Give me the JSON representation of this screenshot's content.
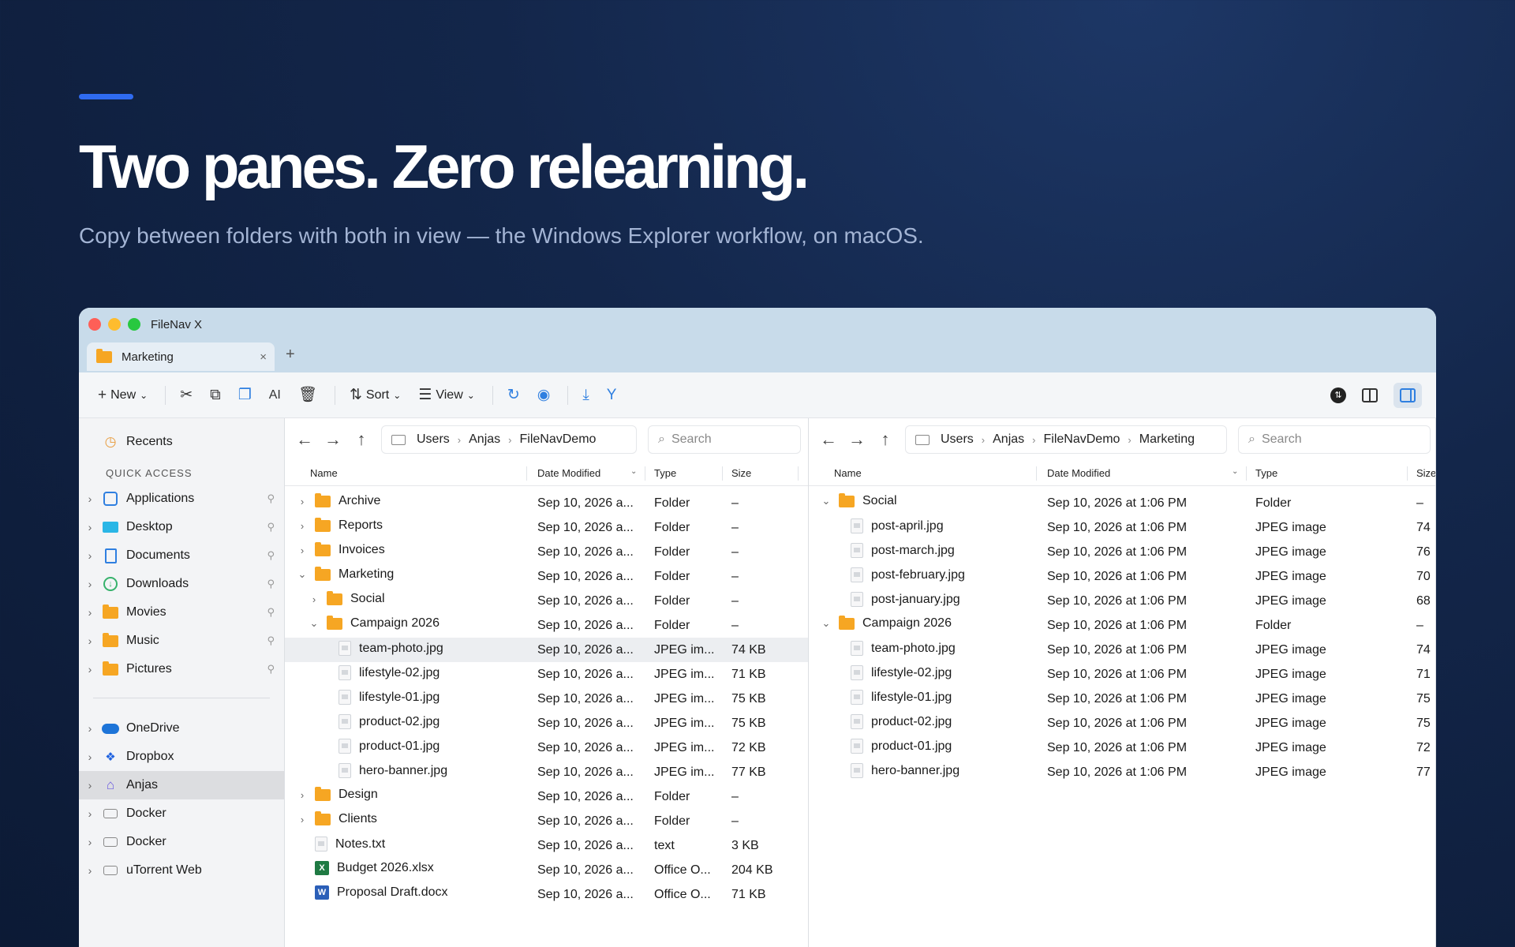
{
  "hero": {
    "headline": "Two panes. Zero relearning.",
    "subline": "Copy between folders with both in view — the Windows Explorer workflow, on macOS."
  },
  "window": {
    "title": "FileNav X",
    "tab": {
      "label": "Marketing",
      "close": "×"
    },
    "new_tab": "+"
  },
  "toolbar": {
    "new_label": "New",
    "sort_label": "Sort",
    "view_label": "View"
  },
  "sidebar": {
    "recents": "Recents",
    "quick_access_header": "QUICK ACCESS",
    "quick_access": [
      "Applications",
      "Desktop",
      "Documents",
      "Downloads",
      "Movies",
      "Music",
      "Pictures"
    ],
    "locations": [
      "OneDrive",
      "Dropbox",
      "Anjas",
      "Docker",
      "Docker",
      "uTorrent Web"
    ]
  },
  "left_pane": {
    "breadcrumb": [
      "Users",
      "Anjas",
      "FileNavDemo"
    ],
    "search_placeholder": "Search",
    "columns": [
      "Name",
      "Date Modified",
      "Type",
      "Size"
    ],
    "rows": [
      {
        "name": "Archive",
        "date": "Sep 10, 2026 a...",
        "type": "Folder",
        "size": "–",
        "level": 0,
        "kind": "folder",
        "chev": "›"
      },
      {
        "name": "Reports",
        "date": "Sep 10, 2026 a...",
        "type": "Folder",
        "size": "–",
        "level": 0,
        "kind": "folder",
        "chev": "›"
      },
      {
        "name": "Invoices",
        "date": "Sep 10, 2026 a...",
        "type": "Folder",
        "size": "–",
        "level": 0,
        "kind": "folder",
        "chev": "›"
      },
      {
        "name": "Marketing",
        "date": "Sep 10, 2026 a...",
        "type": "Folder",
        "size": "–",
        "level": 0,
        "kind": "folder",
        "chev": "⌄"
      },
      {
        "name": "Social",
        "date": "Sep 10, 2026 a...",
        "type": "Folder",
        "size": "–",
        "level": 1,
        "kind": "folder",
        "chev": "›"
      },
      {
        "name": "Campaign 2026",
        "date": "Sep 10, 2026 a...",
        "type": "Folder",
        "size": "–",
        "level": 1,
        "kind": "folder",
        "chev": "⌄"
      },
      {
        "name": "team-photo.jpg",
        "date": "Sep 10, 2026 a...",
        "type": "JPEG im...",
        "size": "74 KB",
        "level": 2,
        "kind": "file",
        "chev": ""
      },
      {
        "name": "lifestyle-02.jpg",
        "date": "Sep 10, 2026 a...",
        "type": "JPEG im...",
        "size": "71 KB",
        "level": 2,
        "kind": "file",
        "chev": ""
      },
      {
        "name": "lifestyle-01.jpg",
        "date": "Sep 10, 2026 a...",
        "type": "JPEG im...",
        "size": "75 KB",
        "level": 2,
        "kind": "file",
        "chev": ""
      },
      {
        "name": "product-02.jpg",
        "date": "Sep 10, 2026 a...",
        "type": "JPEG im...",
        "size": "75 KB",
        "level": 2,
        "kind": "file",
        "chev": ""
      },
      {
        "name": "product-01.jpg",
        "date": "Sep 10, 2026 a...",
        "type": "JPEG im...",
        "size": "72 KB",
        "level": 2,
        "kind": "file",
        "chev": ""
      },
      {
        "name": "hero-banner.jpg",
        "date": "Sep 10, 2026 a...",
        "type": "JPEG im...",
        "size": "77 KB",
        "level": 2,
        "kind": "file",
        "chev": ""
      },
      {
        "name": "Design",
        "date": "Sep 10, 2026 a...",
        "type": "Folder",
        "size": "–",
        "level": 0,
        "kind": "folder",
        "chev": "›"
      },
      {
        "name": "Clients",
        "date": "Sep 10, 2026 a...",
        "type": "Folder",
        "size": "–",
        "level": 0,
        "kind": "folder",
        "chev": "›"
      },
      {
        "name": "Notes.txt",
        "date": "Sep 10, 2026 a...",
        "type": "text",
        "size": "3 KB",
        "level": 0,
        "kind": "file",
        "chev": ""
      },
      {
        "name": "Budget 2026.xlsx",
        "date": "Sep 10, 2026 a...",
        "type": "Office O...",
        "size": "204 KB",
        "level": 0,
        "kind": "xlsx",
        "chev": ""
      },
      {
        "name": "Proposal Draft.docx",
        "date": "Sep 10, 2026 a...",
        "type": "Office O...",
        "size": "71 KB",
        "level": 0,
        "kind": "docx",
        "chev": ""
      }
    ]
  },
  "right_pane": {
    "breadcrumb": [
      "Users",
      "Anjas",
      "FileNavDemo",
      "Marketing"
    ],
    "search_placeholder": "Search",
    "columns": [
      "Name",
      "Date Modified",
      "Type",
      "Size"
    ],
    "rows": [
      {
        "name": "Social",
        "date": "Sep 10, 2026 at 1:06 PM",
        "type": "Folder",
        "size": "–",
        "level": 0,
        "kind": "folder",
        "chev": "⌄"
      },
      {
        "name": "post-april.jpg",
        "date": "Sep 10, 2026 at 1:06 PM",
        "type": "JPEG image",
        "size": "74",
        "level": 1,
        "kind": "file",
        "chev": ""
      },
      {
        "name": "post-march.jpg",
        "date": "Sep 10, 2026 at 1:06 PM",
        "type": "JPEG image",
        "size": "76",
        "level": 1,
        "kind": "file",
        "chev": ""
      },
      {
        "name": "post-february.jpg",
        "date": "Sep 10, 2026 at 1:06 PM",
        "type": "JPEG image",
        "size": "70",
        "level": 1,
        "kind": "file",
        "chev": ""
      },
      {
        "name": "post-january.jpg",
        "date": "Sep 10, 2026 at 1:06 PM",
        "type": "JPEG image",
        "size": "68",
        "level": 1,
        "kind": "file",
        "chev": ""
      },
      {
        "name": "Campaign 2026",
        "date": "Sep 10, 2026 at 1:06 PM",
        "type": "Folder",
        "size": "–",
        "level": 0,
        "kind": "folder",
        "chev": "⌄"
      },
      {
        "name": "team-photo.jpg",
        "date": "Sep 10, 2026 at 1:06 PM",
        "type": "JPEG image",
        "size": "74",
        "level": 1,
        "kind": "file",
        "chev": ""
      },
      {
        "name": "lifestyle-02.jpg",
        "date": "Sep 10, 2026 at 1:06 PM",
        "type": "JPEG image",
        "size": "71",
        "level": 1,
        "kind": "file",
        "chev": ""
      },
      {
        "name": "lifestyle-01.jpg",
        "date": "Sep 10, 2026 at 1:06 PM",
        "type": "JPEG image",
        "size": "75",
        "level": 1,
        "kind": "file",
        "chev": ""
      },
      {
        "name": "product-02.jpg",
        "date": "Sep 10, 2026 at 1:06 PM",
        "type": "JPEG image",
        "size": "75",
        "level": 1,
        "kind": "file",
        "chev": ""
      },
      {
        "name": "product-01.jpg",
        "date": "Sep 10, 2026 at 1:06 PM",
        "type": "JPEG image",
        "size": "72",
        "level": 1,
        "kind": "file",
        "chev": ""
      },
      {
        "name": "hero-banner.jpg",
        "date": "Sep 10, 2026 at 1:06 PM",
        "type": "JPEG image",
        "size": "77",
        "level": 1,
        "kind": "file",
        "chev": ""
      }
    ]
  },
  "colors": {
    "accent": "#2f6bf0",
    "folder": "#f6a623",
    "titlebar": "#c8dbea",
    "selection": "#dcdde0"
  }
}
